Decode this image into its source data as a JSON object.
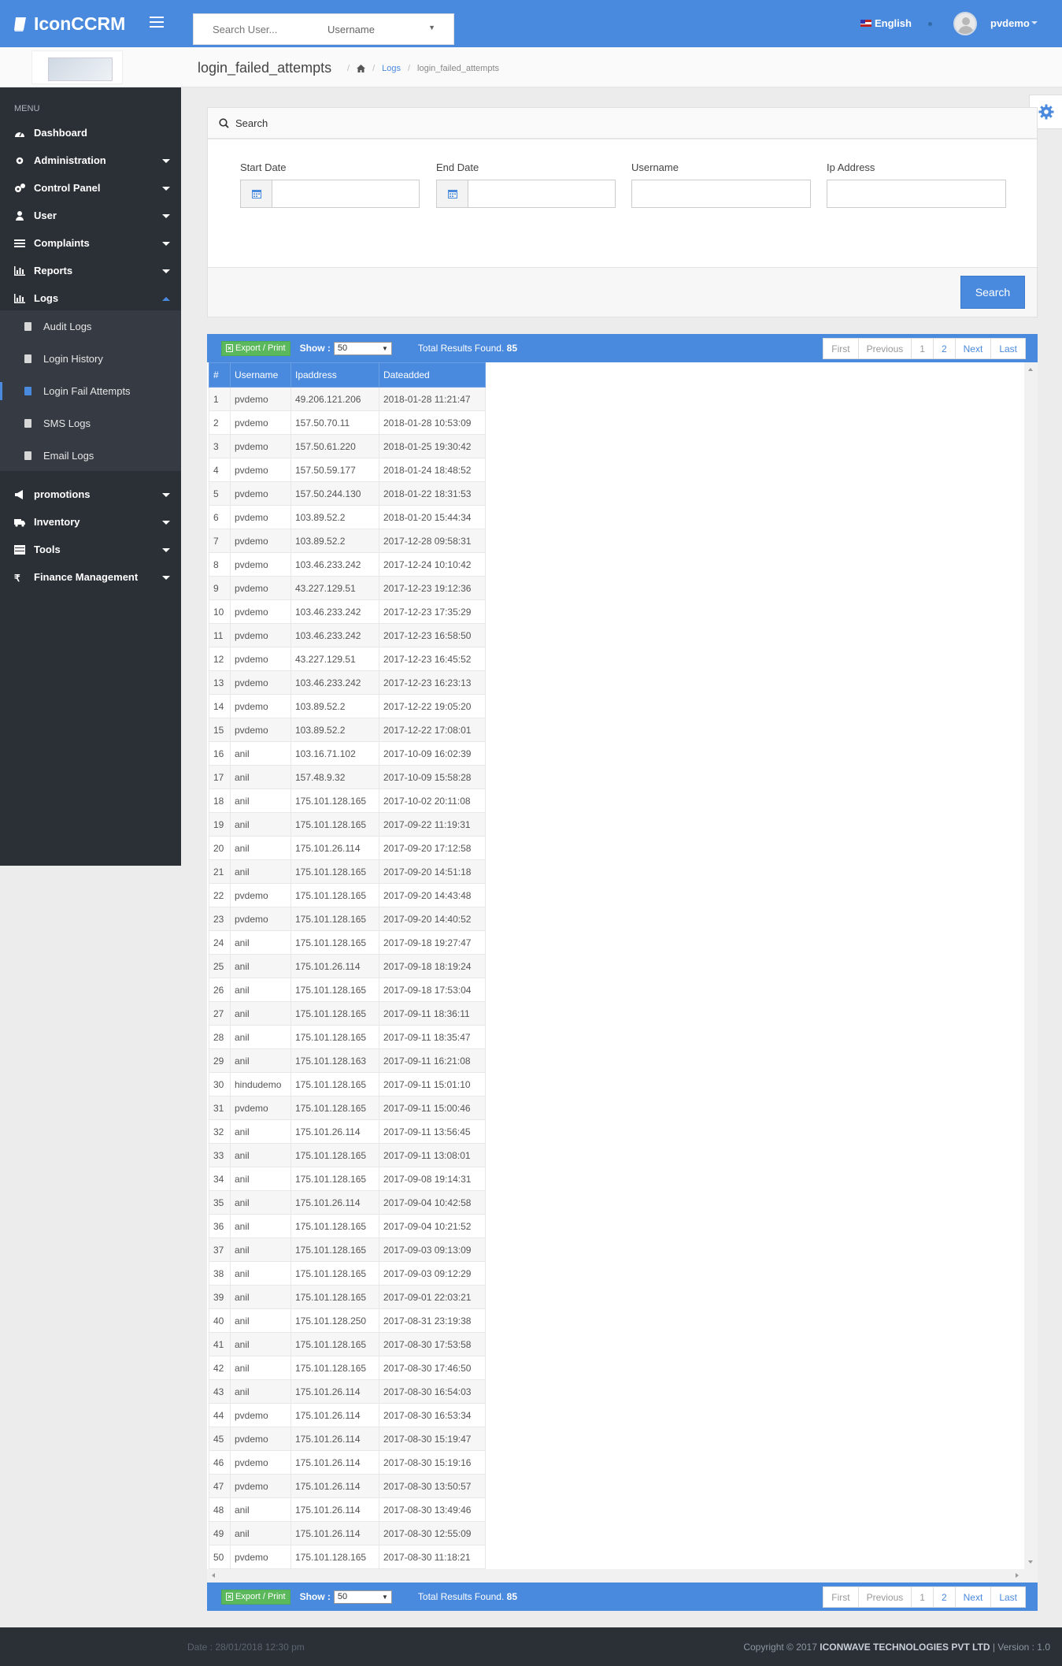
{
  "app": {
    "name": "IconCCRM"
  },
  "header": {
    "search_placeholder": "Search User...",
    "search_field_selected": "Username",
    "language": "English",
    "user_name": "pvdemo"
  },
  "page": {
    "title": "login_failed_attempts",
    "breadcrumb": {
      "logs": "Logs",
      "current": "login_failed_attempts"
    }
  },
  "sidebar": {
    "menu_heading": "MENU",
    "items": [
      {
        "label": "Dashboard",
        "icon": "dashboard-icon"
      },
      {
        "label": "Administration",
        "icon": "gear-icon"
      },
      {
        "label": "Control Panel",
        "icon": "gears-icon"
      },
      {
        "label": "User",
        "icon": "user-icon"
      },
      {
        "label": "Complaints",
        "icon": "list-icon"
      },
      {
        "label": "Reports",
        "icon": "bar-chart-icon"
      },
      {
        "label": "Logs",
        "icon": "bar-chart-icon"
      },
      {
        "label": "promotions",
        "icon": "bullhorn-icon"
      },
      {
        "label": "Inventory",
        "icon": "truck-icon"
      },
      {
        "label": "Tools",
        "icon": "table-icon"
      },
      {
        "label": "Finance Management",
        "icon": "rupee-icon"
      }
    ],
    "logs_sub": [
      "Audit Logs",
      "Login History",
      "Login Fail Attempts",
      "SMS Logs",
      "Email Logs"
    ]
  },
  "search_panel": {
    "heading": "Search",
    "fields": {
      "start_date": "Start Date",
      "end_date": "End Date",
      "username": "Username",
      "ip": "Ip Address"
    },
    "button": "Search"
  },
  "results": {
    "export_label": "Export / Print",
    "show_label": "Show :",
    "show_value": "50",
    "total_label": "Total Results Found.",
    "total_count": "85",
    "pager": {
      "first": "First",
      "previous": "Previous",
      "p1": "1",
      "p2": "2",
      "next": "Next",
      "last": "Last"
    },
    "columns": [
      "#",
      "Username",
      "Ipaddress",
      "Dateadded"
    ],
    "rows": [
      [
        "1",
        "pvdemo",
        "49.206.121.206",
        "2018-01-28 11:21:47"
      ],
      [
        "2",
        "pvdemo",
        "157.50.70.11",
        "2018-01-28 10:53:09"
      ],
      [
        "3",
        "pvdemo",
        "157.50.61.220",
        "2018-01-25 19:30:42"
      ],
      [
        "4",
        "pvdemo",
        "157.50.59.177",
        "2018-01-24 18:48:52"
      ],
      [
        "5",
        "pvdemo",
        "157.50.244.130",
        "2018-01-22 18:31:53"
      ],
      [
        "6",
        "pvdemo",
        "103.89.52.2",
        "2018-01-20 15:44:34"
      ],
      [
        "7",
        "pvdemo",
        "103.89.52.2",
        "2017-12-28 09:58:31"
      ],
      [
        "8",
        "pvdemo",
        "103.46.233.242",
        "2017-12-24 10:10:42"
      ],
      [
        "9",
        "pvdemo",
        "43.227.129.51",
        "2017-12-23 19:12:36"
      ],
      [
        "10",
        "pvdemo",
        "103.46.233.242",
        "2017-12-23 17:35:29"
      ],
      [
        "11",
        "pvdemo",
        "103.46.233.242",
        "2017-12-23 16:58:50"
      ],
      [
        "12",
        "pvdemo",
        "43.227.129.51",
        "2017-12-23 16:45:52"
      ],
      [
        "13",
        "pvdemo",
        "103.46.233.242",
        "2017-12-23 16:23:13"
      ],
      [
        "14",
        "pvdemo",
        "103.89.52.2",
        "2017-12-22 19:05:20"
      ],
      [
        "15",
        "pvdemo",
        "103.89.52.2",
        "2017-12-22 17:08:01"
      ],
      [
        "16",
        "anil",
        "103.16.71.102",
        "2017-10-09 16:02:39"
      ],
      [
        "17",
        "anil",
        "157.48.9.32",
        "2017-10-09 15:58:28"
      ],
      [
        "18",
        "anil",
        "175.101.128.165",
        "2017-10-02 20:11:08"
      ],
      [
        "19",
        "anil",
        "175.101.128.165",
        "2017-09-22 11:19:31"
      ],
      [
        "20",
        "anil",
        "175.101.26.114",
        "2017-09-20 17:12:58"
      ],
      [
        "21",
        "anil",
        "175.101.128.165",
        "2017-09-20 14:51:18"
      ],
      [
        "22",
        "pvdemo",
        "175.101.128.165",
        "2017-09-20 14:43:48"
      ],
      [
        "23",
        "pvdemo",
        "175.101.128.165",
        "2017-09-20 14:40:52"
      ],
      [
        "24",
        "anil",
        "175.101.128.165",
        "2017-09-18 19:27:47"
      ],
      [
        "25",
        "anil",
        "175.101.26.114",
        "2017-09-18 18:19:24"
      ],
      [
        "26",
        "anil",
        "175.101.128.165",
        "2017-09-18 17:53:04"
      ],
      [
        "27",
        "anil",
        "175.101.128.165",
        "2017-09-11 18:36:11"
      ],
      [
        "28",
        "anil",
        "175.101.128.165",
        "2017-09-11 18:35:47"
      ],
      [
        "29",
        "anil",
        "175.101.128.163",
        "2017-09-11 16:21:08"
      ],
      [
        "30",
        "hindudemo",
        "175.101.128.165",
        "2017-09-11 15:01:10"
      ],
      [
        "31",
        "pvdemo",
        "175.101.128.165",
        "2017-09-11 15:00:46"
      ],
      [
        "32",
        "anil",
        "175.101.26.114",
        "2017-09-11 13:56:45"
      ],
      [
        "33",
        "anil",
        "175.101.128.165",
        "2017-09-11 13:08:01"
      ],
      [
        "34",
        "anil",
        "175.101.128.165",
        "2017-09-08 19:14:31"
      ],
      [
        "35",
        "anil",
        "175.101.26.114",
        "2017-09-04 10:42:58"
      ],
      [
        "36",
        "anil",
        "175.101.128.165",
        "2017-09-04 10:21:52"
      ],
      [
        "37",
        "anil",
        "175.101.128.165",
        "2017-09-03 09:13:09"
      ],
      [
        "38",
        "anil",
        "175.101.128.165",
        "2017-09-03 09:12:29"
      ],
      [
        "39",
        "anil",
        "175.101.128.165",
        "2017-09-01 22:03:21"
      ],
      [
        "40",
        "anil",
        "175.101.128.250",
        "2017-08-31 23:19:38"
      ],
      [
        "41",
        "anil",
        "175.101.128.165",
        "2017-08-30 17:53:58"
      ],
      [
        "42",
        "anil",
        "175.101.128.165",
        "2017-08-30 17:46:50"
      ],
      [
        "43",
        "anil",
        "175.101.26.114",
        "2017-08-30 16:54:03"
      ],
      [
        "44",
        "pvdemo",
        "175.101.26.114",
        "2017-08-30 16:53:34"
      ],
      [
        "45",
        "pvdemo",
        "175.101.26.114",
        "2017-08-30 15:19:47"
      ],
      [
        "46",
        "pvdemo",
        "175.101.26.114",
        "2017-08-30 15:19:16"
      ],
      [
        "47",
        "pvdemo",
        "175.101.26.114",
        "2017-08-30 13:50:57"
      ],
      [
        "48",
        "anil",
        "175.101.26.114",
        "2017-08-30 13:49:46"
      ],
      [
        "49",
        "anil",
        "175.101.26.114",
        "2017-08-30 12:55:09"
      ],
      [
        "50",
        "pvdemo",
        "175.101.128.165",
        "2017-08-30 11:18:21"
      ]
    ]
  },
  "footer": {
    "date": "Date : 28/01/2018 12:30 pm",
    "copyright_prefix": "Copyright © 2017",
    "company": "ICONWAVE TECHNOLOGIES PVT LTD",
    "version": "| Version : 1.0"
  },
  "colors": {
    "primary": "#4a8ade",
    "sidebar": "#2b3037",
    "export": "#5cb85c"
  }
}
